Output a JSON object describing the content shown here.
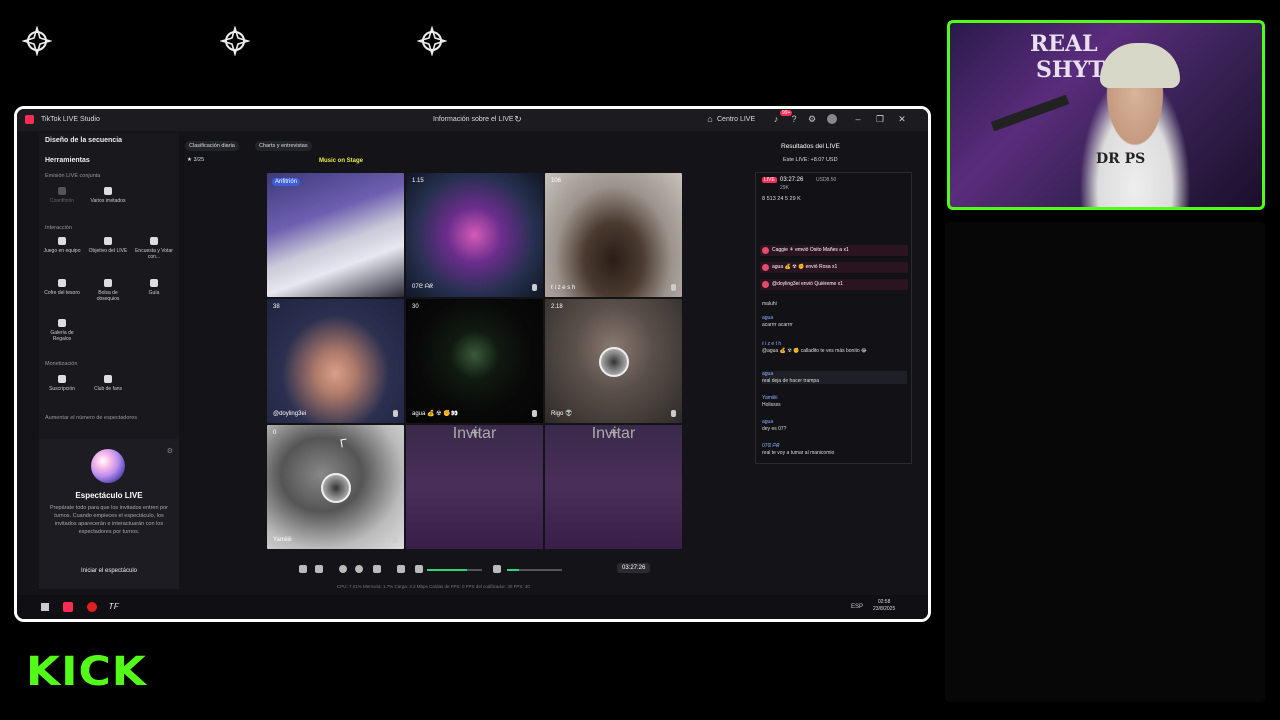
{
  "overlay": {
    "kick_logo": "KICK",
    "stage_icons": [
      "star-logo-icon",
      "star-logo-icon",
      "star-logo-icon"
    ]
  },
  "webcam": {
    "wall_texts": [
      "REAL",
      "SHYT",
      "DR PS"
    ]
  },
  "app": {
    "title": "TikTok LIVE Studio",
    "center_title": "Información sobre el LIVE",
    "centro_live": "Centro LIVE",
    "notif_badge": "99+"
  },
  "left_panel": {
    "scene_design": "Diseño de la secuencia",
    "tools_heading": "Herramientas",
    "joint_live": "Emisión LIVE conjunta",
    "tools_joint": [
      {
        "label": "Coanfitrión",
        "enabled": false
      },
      {
        "label": "Varios invitados",
        "enabled": true
      }
    ],
    "interaction_heading": "Interacción",
    "tools_interaction": [
      {
        "label": "Juego en equipo"
      },
      {
        "label": "Objetivo del LIVE"
      },
      {
        "label": "Encuesta y Votar con..."
      },
      {
        "label": "Cofre del tesoro"
      },
      {
        "label": "Bolsa de obsequios"
      },
      {
        "label": "Guía"
      },
      {
        "label": "Galería de Regalos"
      }
    ],
    "monetization_heading": "Monetización",
    "tools_monetization": [
      {
        "label": "Suscripción"
      },
      {
        "label": "Club de fans"
      }
    ],
    "increase_viewers": "Aumentar el número de espectadores",
    "show_card": {
      "title": "Espectáculo LIVE",
      "description": "Prepárate todo para que los invitados entren por turnos. Cuando empieces el espectáculo, los invitados aparecerán e interactuarán con los espectadores por turnos.",
      "button": "Iniciar el espectáculo"
    }
  },
  "top_bar": {
    "tag_ranking": "Clasificación diaria",
    "tag_charts": "Charts y entrevistas",
    "score": "3/25",
    "music_on_stage": "Music on Stage"
  },
  "grid": {
    "cells": [
      {
        "label": "",
        "count": "",
        "host_tag": "Anfitrión",
        "style": "c1"
      },
      {
        "label": "07ᘓ ᗩᖇ",
        "count": "1.15",
        "host_tag": "",
        "style": "c2"
      },
      {
        "label": "ℓ i z e s h",
        "count": "106",
        "host_tag": "",
        "style": "c3"
      },
      {
        "label": "@doyling3ei",
        "count": "38",
        "host_tag": "",
        "style": "c4"
      },
      {
        "label": "agua 💰 ☢ ✊👀",
        "count": "30",
        "host_tag": "",
        "style": "c5"
      },
      {
        "label": "Rigo 👽",
        "count": "2.18",
        "host_tag": "",
        "style": "c6"
      },
      {
        "label": "Yamiiiii",
        "count": "0",
        "host_tag": "",
        "style": "c7"
      }
    ],
    "invite_label": "Invitar"
  },
  "controls": {
    "timer": "03:27:26",
    "volume_level": 0.72,
    "mic_level": 0.22
  },
  "status_line": "CPU: 7.01%    Memoria: 1.7%    Carga: 3.3 Mbps    Caídas de FPS: 0    FPS del codificador: 30    FPS: 30",
  "right_panel": {
    "heading": "Resultados del LIVE",
    "estimated": "Este LIVE: +8.07 USD",
    "chat": {
      "live_badge": "LIVE",
      "time": "03:27:26",
      "usd": "USD8.50",
      "likes": "29K",
      "stats": "8   513   24   5   29 K",
      "gifts": [
        "Caggie ⚘ emvió Osito Mañes a  x1",
        "agua 💰 ☢ ✊ envió Rosa  x1",
        "@doyling3ei envió Quiéreme  x1"
      ],
      "messages": [
        {
          "user": "",
          "text": "maluhi"
        },
        {
          "user": "agua",
          "text": "acarrrr acarrrr"
        },
        {
          "user": "ℓ i z e t h",
          "text": "@agua 💰 ☢ ✊ calladito te ves más bonito 😂"
        },
        {
          "user": "agua",
          "text": "real deja de hacer trampa"
        },
        {
          "user": "Yamiiiii",
          "text": "Holissss"
        },
        {
          "user": "agua",
          "text": "dey es 07?"
        },
        {
          "user": "07ᘓ ᗩᖇ",
          "text": "real te voy a tumar al manicomio"
        }
      ]
    }
  },
  "taskbar": {
    "lang": "ESP",
    "time": "02:58",
    "date": "23/8/2025"
  },
  "colors": {
    "kick_green": "#53fc18",
    "tiktok_red": "#fe2c55",
    "level_green": "#2bd67b"
  }
}
